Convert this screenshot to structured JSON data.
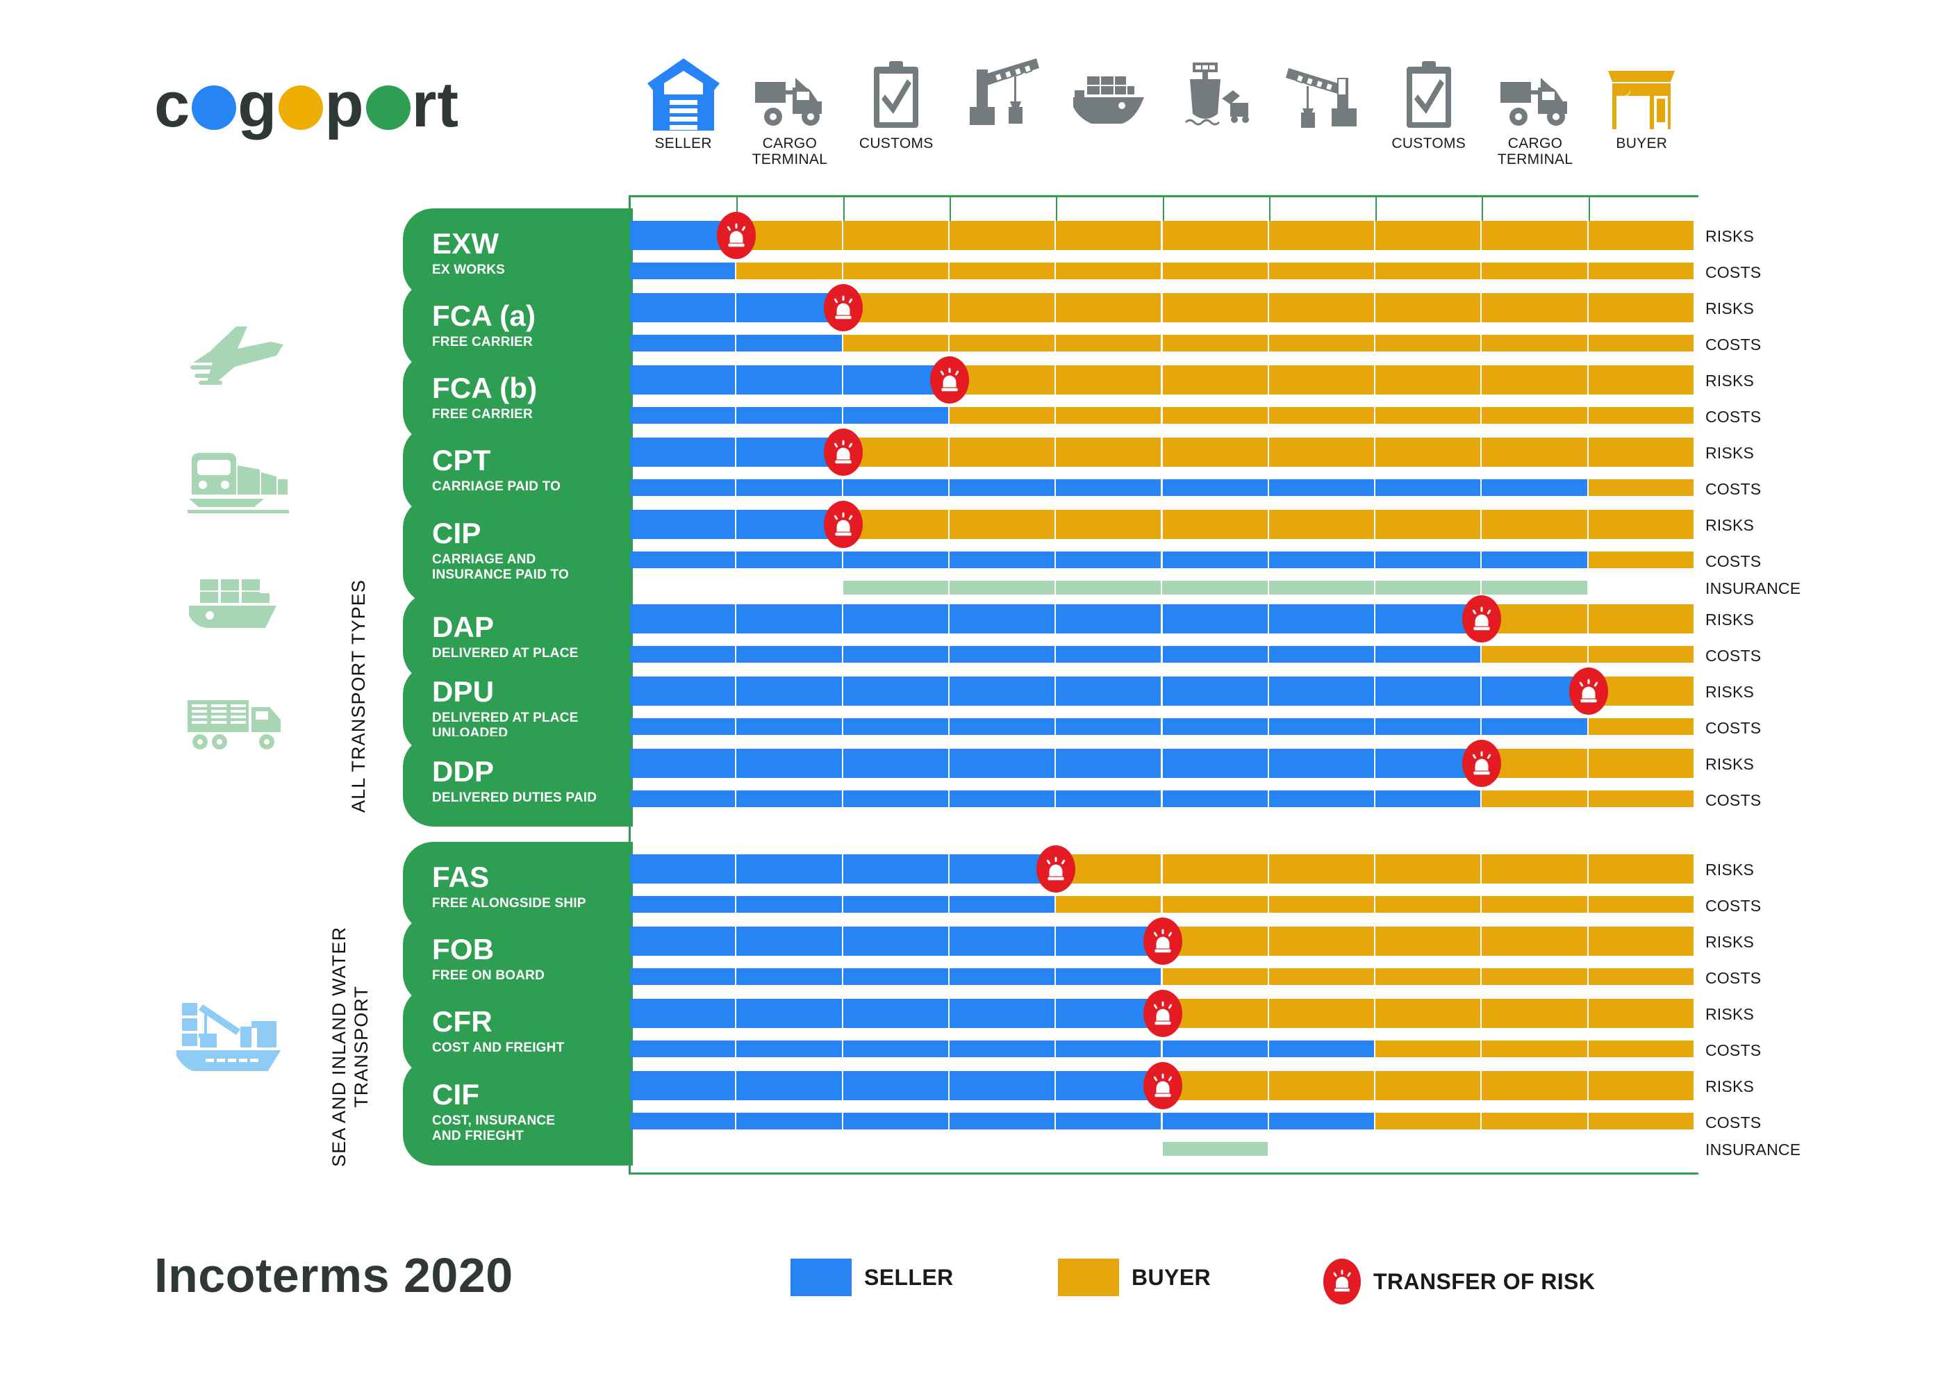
{
  "brand": {
    "name_parts": [
      "c",
      "o",
      "g",
      "o",
      "p",
      "o",
      "rt"
    ],
    "colors": {
      "blue": "#2684f4",
      "yellow": "#eead03",
      "green": "#2e9e53",
      "dark": "#2f3737"
    }
  },
  "title": "Incoterms 2020",
  "header_columns": [
    {
      "icon": "warehouse-icon",
      "label": "SELLER",
      "col": 0
    },
    {
      "icon": "truck-icon",
      "label": "CARGO\nTERMINAL",
      "col": 1
    },
    {
      "icon": "customs-clipboard-icon",
      "label": "CUSTOMS",
      "col": 2
    },
    {
      "icon": "crane-icon",
      "label": "",
      "col": 3
    },
    {
      "icon": "cargo-ship-icon",
      "label": "",
      "col": 4
    },
    {
      "icon": "ship-arriving-icon",
      "label": "",
      "col": 5
    },
    {
      "icon": "crane-unload-icon",
      "label": "",
      "col": 6
    },
    {
      "icon": "customs-clipboard-icon",
      "label": "CUSTOMS",
      "col": 7
    },
    {
      "icon": "truck-icon",
      "label": "CARGO\nTERMINAL",
      "col": 8
    },
    {
      "icon": "storefront-icon",
      "label": "BUYER",
      "col": 9
    }
  ],
  "groups": [
    {
      "name": "ALL TRANSPORT TYPES",
      "icons": [
        "plane-icon",
        "train-icon",
        "cargo-ship-icon",
        "truck-container-icon"
      ]
    },
    {
      "name": "SEA AND INLAND WATER\nTRANSPORT",
      "icons": [
        "port-crane-ship-icon"
      ]
    }
  ],
  "row_labels": {
    "risks": "RISKS",
    "costs": "COSTS",
    "insurance": "INSURANCE"
  },
  "legend": {
    "items": [
      {
        "label": "SELLER",
        "color": "#2684f4",
        "type": "swatch"
      },
      {
        "label": "BUYER",
        "color": "#e5a70c",
        "type": "swatch"
      },
      {
        "label": "TRANSFER OF RISK",
        "color": "#e41b23",
        "type": "marker"
      }
    ]
  },
  "chart_data": {
    "type": "bar",
    "title": "Incoterms 2020",
    "description": "Horizontal stacked responsibility bars showing where risk and cost transfer from seller to buyer across 10 shipment stages.",
    "stages": [
      "SELLER",
      "CARGO TERMINAL",
      "CUSTOMS",
      "CRANE LOAD",
      "SEA FREIGHT",
      "SHIP ARRIVAL",
      "CRANE UNLOAD",
      "CUSTOMS",
      "CARGO TERMINAL",
      "BUYER"
    ],
    "axis": {
      "columns": 10,
      "seller_color": "#2684f4",
      "buyer_color": "#e5a70c",
      "insurance_color": "#a8d6b4"
    },
    "groups": [
      {
        "name": "ALL TRANSPORT TYPES",
        "terms": [
          {
            "code": "EXW",
            "name": "EX WORKS",
            "risks_seller_cols": 1,
            "costs_seller_cols": 1,
            "risk_transfer_col": 1,
            "insurance": null
          },
          {
            "code": "FCA (a)",
            "name": "FREE CARRIER",
            "risks_seller_cols": 2,
            "costs_seller_cols": 2,
            "risk_transfer_col": 2,
            "insurance": null
          },
          {
            "code": "FCA (b)",
            "name": "FREE CARRIER",
            "risks_seller_cols": 3,
            "costs_seller_cols": 3,
            "risk_transfer_col": 3,
            "insurance": null
          },
          {
            "code": "CPT",
            "name": "CARRIAGE PAID TO",
            "risks_seller_cols": 2,
            "costs_seller_cols": 9,
            "risk_transfer_col": 2,
            "insurance": null
          },
          {
            "code": "CIP",
            "name": "CARRIAGE AND\nINSURANCE PAID TO",
            "risks_seller_cols": 2,
            "costs_seller_cols": 9,
            "risk_transfer_col": 2,
            "insurance": {
              "from_col": 2,
              "to_col": 9
            }
          },
          {
            "code": "DAP",
            "name": "DELIVERED AT PLACE",
            "risks_seller_cols": 8,
            "costs_seller_cols": 8,
            "risk_transfer_col": 8,
            "insurance": null
          },
          {
            "code": "DPU",
            "name": "DELIVERED AT PLACE UNLOADED",
            "risks_seller_cols": 9,
            "costs_seller_cols": 9,
            "risk_transfer_col": 9,
            "insurance": null
          },
          {
            "code": "DDP",
            "name": "DELIVERED DUTIES PAID",
            "risks_seller_cols": 8,
            "costs_seller_cols": 8,
            "risk_transfer_col": 8,
            "insurance": null
          }
        ]
      },
      {
        "name": "SEA AND INLAND WATER TRANSPORT",
        "terms": [
          {
            "code": "FAS",
            "name": "FREE ALONGSIDE SHIP",
            "risks_seller_cols": 4,
            "costs_seller_cols": 4,
            "risk_transfer_col": 4,
            "insurance": null
          },
          {
            "code": "FOB",
            "name": "FREE ON BOARD",
            "risks_seller_cols": 5,
            "costs_seller_cols": 5,
            "risk_transfer_col": 5,
            "insurance": null
          },
          {
            "code": "CFR",
            "name": "COST AND FREIGHT",
            "risks_seller_cols": 5,
            "costs_seller_cols": 7,
            "risk_transfer_col": 5,
            "insurance": null
          },
          {
            "code": "CIF",
            "name": "COST, INSURANCE\nAND FRIEGHT",
            "risks_seller_cols": 5,
            "costs_seller_cols": 7,
            "risk_transfer_col": 5,
            "insurance": {
              "from_col": 5,
              "to_col": 6
            }
          }
        ]
      }
    ]
  }
}
